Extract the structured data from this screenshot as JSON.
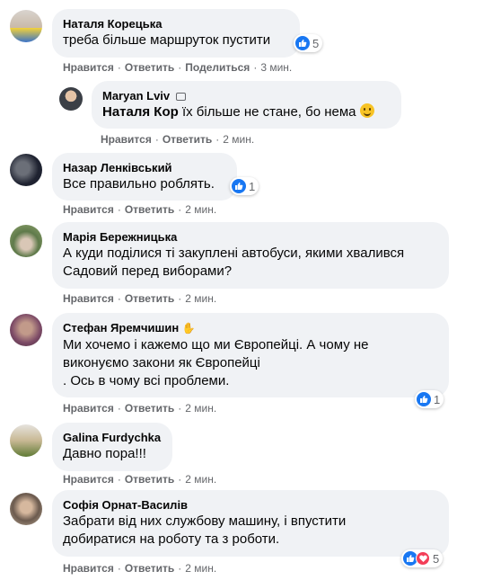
{
  "actions": {
    "like": "Нравится",
    "reply": "Ответить",
    "share": "Поделиться",
    "dot": "·"
  },
  "comments": [
    {
      "author": "Наталя Корецька",
      "text": "треба більше маршруток пустити",
      "time": "3 мин.",
      "reactions": "5",
      "has_share": true
    },
    {
      "author": "Maryan Lviv",
      "mention": "Наталя Кор",
      "text": " їх більше не стане, бо нема ",
      "time": "2 мин."
    },
    {
      "author": "Назар Ленківський",
      "text": "Все правильно роблять.",
      "time": "2 мин.",
      "reactions": "1"
    },
    {
      "author": "Марія Бережницька",
      "lines": [
        "А куди поділися ті закуплені автобуси, якими хвалився",
        "Садовий перед виборами?"
      ],
      "time": "2 мин."
    },
    {
      "author": "Стефан Яремчишин",
      "lines": [
        "Ми хочемо і кажемо що ми Європейці. А чому не",
        "виконуємо закони як Європейці",
        ". Ось в чому всі проблеми."
      ],
      "time": "2 мин.",
      "reactions": "1"
    },
    {
      "author": "Galina Furdychka",
      "text": "Давно пора!!!",
      "time": "2 мин."
    },
    {
      "author": "Софія Орнат-Василів",
      "lines": [
        "Забрати від них службову машину, і впустити",
        "добиратися на роботу та з роботи."
      ],
      "time": "2 мин.",
      "reactions": "5"
    }
  ],
  "colors": {
    "bubble": "#f0f2f5",
    "meta": "#65676b",
    "like": "#1877f2",
    "love": "#f33e58"
  }
}
